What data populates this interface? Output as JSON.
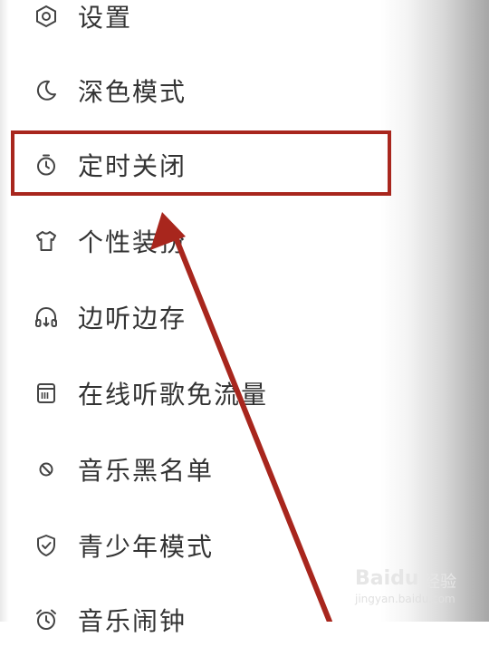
{
  "menu": {
    "items": [
      {
        "label": "设置",
        "icon": "settings-hexagon-icon"
      },
      {
        "label": "深色模式",
        "icon": "moon-icon"
      },
      {
        "label": "定时关闭",
        "icon": "timer-icon"
      },
      {
        "label": "个性装扮",
        "icon": "tshirt-icon"
      },
      {
        "label": "边听边存",
        "icon": "headphones-download-icon"
      },
      {
        "label": "在线听歌免流量",
        "icon": "sim-card-icon"
      },
      {
        "label": "音乐黑名单",
        "icon": "block-icon"
      },
      {
        "label": "青少年模式",
        "icon": "shield-check-icon"
      },
      {
        "label": "音乐闹钟",
        "icon": "alarm-clock-icon"
      }
    ]
  },
  "annotation": {
    "highlight_color": "#a8261d",
    "highlighted_item": "定时关闭"
  },
  "watermark": {
    "brand": "Baidu",
    "sub": "经验",
    "url": "jingyan.baidu.com"
  }
}
